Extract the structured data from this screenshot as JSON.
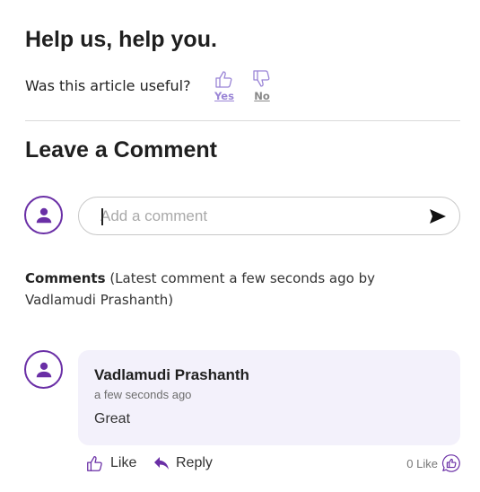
{
  "feedback": {
    "title": "Help us, help you.",
    "question": "Was this article useful?",
    "yes_label": "Yes",
    "no_label": "No"
  },
  "comment_form": {
    "heading": "Leave a Comment",
    "placeholder": "Add a comment"
  },
  "comments_summary": {
    "label": "Comments",
    "detail": "(Latest comment a few seconds ago by Vadlamudi Prashanth)"
  },
  "comments": [
    {
      "author": "Vadlamudi Prashanth",
      "time": "a few seconds ago",
      "text": "Great",
      "like_label": "Like",
      "reply_label": "Reply",
      "like_count": "0 Like"
    }
  ],
  "icons": {
    "avatar": "user-icon",
    "send": "send-icon",
    "yes": "thumbs-up-icon",
    "no": "thumbs-down-icon",
    "like": "thumbs-up-icon",
    "reply": "reply-arrow-icon",
    "like_count": "thumbs-up-bubble-icon"
  },
  "colors": {
    "accent": "#6a2fa6",
    "yes_link": "#9a85d6",
    "comment_card_bg": "#f3f1fb"
  }
}
